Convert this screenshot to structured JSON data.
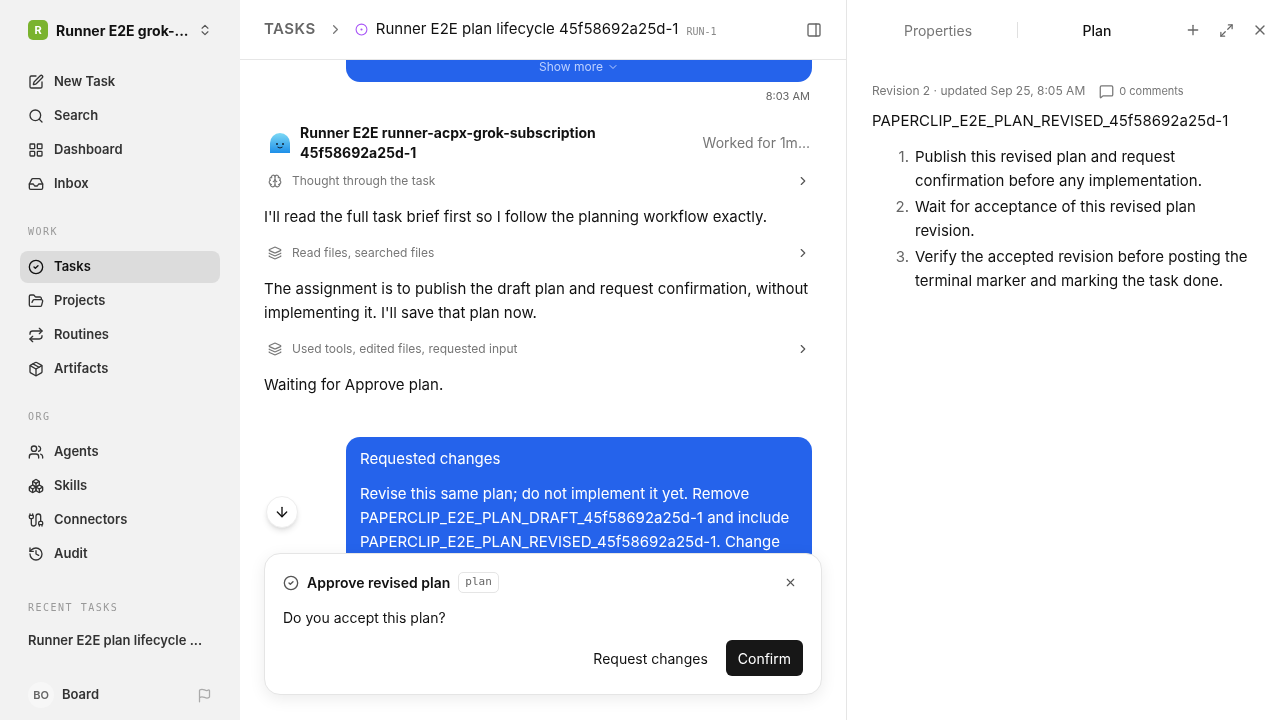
{
  "workspace": {
    "initial": "R",
    "name": "Runner E2E grok-..."
  },
  "nav": [
    {
      "label": "New Task",
      "selected": false
    },
    {
      "label": "Search",
      "selected": false
    },
    {
      "label": "Dashboard",
      "selected": false
    },
    {
      "label": "Inbox",
      "selected": false
    }
  ],
  "sections": [
    {
      "title": "WORK",
      "items": [
        {
          "label": "Tasks",
          "selected": true
        },
        {
          "label": "Projects",
          "selected": false
        },
        {
          "label": "Routines",
          "selected": false
        },
        {
          "label": "Artifacts",
          "selected": false
        }
      ]
    },
    {
      "title": "ORG",
      "items": [
        {
          "label": "Agents",
          "selected": false
        },
        {
          "label": "Skills",
          "selected": false
        },
        {
          "label": "Connectors",
          "selected": false
        },
        {
          "label": "Audit",
          "selected": false
        }
      ]
    }
  ],
  "recent": {
    "title": "RECENT TASKS",
    "items": [
      "Runner E2E plan lifecycle ..."
    ]
  },
  "user": {
    "initials": "BO",
    "name": "Board"
  },
  "breadcrumb": {
    "root": "TASKS",
    "title": "Runner E2E plan lifecycle 45f58692a25d-1",
    "id": "RUN-1"
  },
  "thread": {
    "show_more": "Show more",
    "time": "8:03 AM",
    "agent": {
      "name": "Runner E2E runner-acpx-grok-subscription 45f58692a25d-1",
      "status": "Worked for 1m..."
    },
    "entries": [
      {
        "kind": "thought",
        "text": "Thought through the task"
      },
      {
        "kind": "message",
        "text": "I'll read the full task brief first so I follow the planning workflow exactly."
      },
      {
        "kind": "action",
        "text": "Read files, searched files"
      },
      {
        "kind": "message",
        "text": "The assignment is to publish the draft plan and request confirmation, without implementing it. I'll save that plan now."
      },
      {
        "kind": "action",
        "text": "Used tools, edited files, requested input"
      },
      {
        "kind": "message",
        "text": "Waiting for Approve plan."
      }
    ],
    "request": {
      "title": "Requested changes",
      "text": "Revise this same plan; do not implement it yet. Remove PAPERCLIP_E2E_PLAN_DRAFT_45f58692a25d-1 and include PAPERCLIP_E2E_PLAN_REVISED_45f58692a25d-1. Change"
    }
  },
  "approval": {
    "title": "Approve revised plan",
    "tag": "plan",
    "question": "Do you accept this plan?",
    "buttons": [
      "Request changes",
      "Confirm"
    ]
  },
  "panel": {
    "tabs": [
      {
        "label": "Properties",
        "selected": false
      },
      {
        "label": "Plan",
        "selected": true
      }
    ],
    "meta": "Revision 2 · updated Sep 25, 8:05 AM",
    "comments": "0 comments",
    "heading": "PAPERCLIP_E2E_PLAN_REVISED_45f58692a25d-1",
    "steps": [
      {
        "number": "1.",
        "text": "Publish this revised plan and request confirmation before any implementation."
      },
      {
        "number": "2.",
        "text": "Wait for acceptance of this revised plan revision."
      },
      {
        "number": "3.",
        "text": "Verify the accepted revision before posting the terminal marker and marking the task done."
      }
    ]
  }
}
